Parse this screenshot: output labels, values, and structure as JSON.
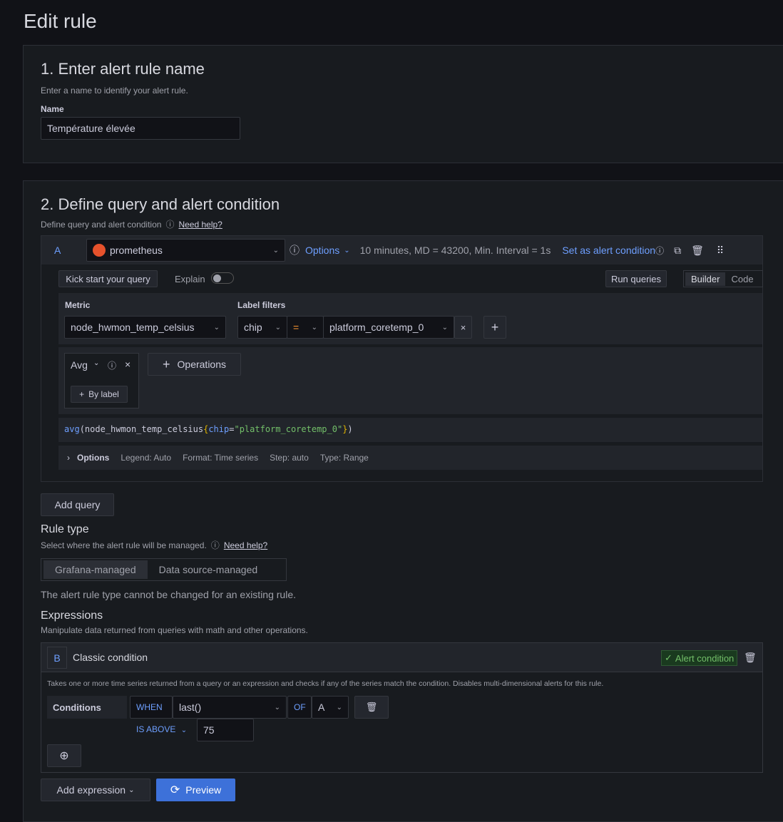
{
  "page_title": "Edit rule",
  "section1": {
    "title": "1. Enter alert rule name",
    "subtitle": "Enter a name to identify your alert rule.",
    "name_label": "Name",
    "name_value": "Température élevée"
  },
  "section2": {
    "title": "2. Define query and alert condition",
    "subtitle": "Define query and alert condition",
    "need_help": "Need help?",
    "query": {
      "ref": "A",
      "datasource": "prometheus",
      "options_label": "Options",
      "options_summary": "10 minutes, MD = 43200, Min. Interval = 1s",
      "set_alert": "Set as alert condition",
      "kick_start": "Kick start your query",
      "explain": "Explain",
      "explain_on": false,
      "run_queries": "Run queries",
      "builder": "Builder",
      "code": "Code",
      "mode": "Builder",
      "metric_label": "Metric",
      "metric": "node_hwmon_temp_celsius",
      "label_filters_label": "Label filters",
      "filter_label": "chip",
      "filter_op": "=",
      "filter_value": "platform_coretemp_0",
      "remove": "×",
      "add": "+",
      "operation": "Avg",
      "op_remove": "×",
      "operations_btn": "Operations",
      "by_label": "By label",
      "expr": {
        "fn": "avg",
        "open": "(",
        "metric": "node_hwmon_temp_celsius",
        "lb": "{",
        "key": "chip",
        "eq": "=",
        "val": "\"platform_coretemp_0\"",
        "rb": "}",
        "close": ")"
      },
      "options_row": {
        "label": "Options",
        "legend": "Legend: Auto",
        "format": "Format: Time series",
        "step": "Step: auto",
        "type": "Type: Range"
      }
    },
    "add_query": "Add query",
    "rule_type": {
      "title": "Rule type",
      "subtitle": "Select where the alert rule will be managed.",
      "need_help": "Need help?",
      "options": [
        "Grafana-managed",
        "Data source-managed"
      ],
      "selected": "Grafana-managed",
      "note": "The alert rule type cannot be changed for an existing rule."
    },
    "expressions": {
      "title": "Expressions",
      "subtitle": "Manipulate data returned from queries with math and other operations.",
      "card": {
        "ref": "B",
        "name": "Classic condition",
        "badge": "Alert condition",
        "description": "Takes one or more time series returned from a query or an expression and checks if any of the series match the condition. Disables multi-dimensional alerts for this rule.",
        "conditions_label": "Conditions",
        "when": "WHEN",
        "reducer": "last()",
        "of": "OF",
        "query_ref": "A",
        "evaluator": "IS ABOVE",
        "threshold": "75"
      }
    },
    "add_expression": "Add expression",
    "preview": "Preview"
  },
  "colors": {
    "background": "#111217",
    "panel": "#181b1f",
    "accent": "#6e9fff",
    "primary": "#3d71d9",
    "success": "#73bf69",
    "prometheus": "#e6522c"
  }
}
